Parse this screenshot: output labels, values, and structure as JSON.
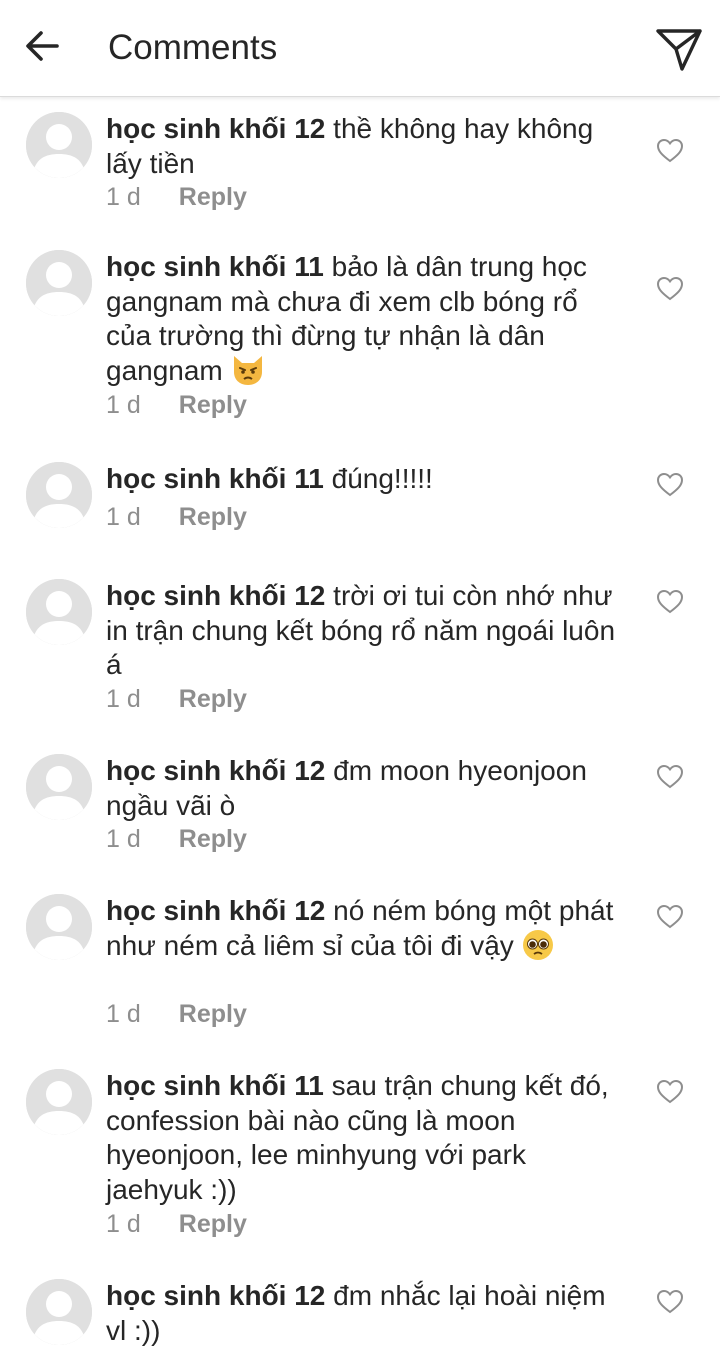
{
  "header": {
    "title": "Comments",
    "back_icon": "arrow-left-icon",
    "share_icon": "paper-plane-icon"
  },
  "comments": [
    {
      "username": "học sinh khối 12",
      "text": "thề không hay không lấy tiền",
      "time": "1 d",
      "reply": "Reply"
    },
    {
      "username": "học sinh khối 11",
      "text": "bảo là dân trung học gangnam mà chưa đi xem clb bóng rổ của trường thì đừng tự nhận là dân gangnam",
      "emoji": "angry-cat-emoji",
      "time": "1 d",
      "reply": "Reply"
    },
    {
      "username": "học sinh khối 11",
      "text": "đúng!!!!!",
      "time": "1 d",
      "reply": "Reply"
    },
    {
      "username": "học sinh khối 12",
      "text": "trời ơi tui còn nhớ như in trận chung kết bóng rổ năm ngoái luôn á",
      "time": "1 d",
      "reply": "Reply"
    },
    {
      "username": "học sinh khối 12",
      "text": "đm moon hyeonjoon ngầu vãi ò",
      "time": "1 d",
      "reply": "Reply"
    },
    {
      "username": "học sinh khối 12",
      "text": "nó ném bóng một phát như ném cả liêm sỉ của tôi đi vậy",
      "emoji": "pleading-face-emoji",
      "time": "1 d",
      "reply": "Reply"
    },
    {
      "username": "học sinh khối 11",
      "text": "sau trận chung kết đó, confession bài nào cũng là moon hyeonjoon, lee minhyung với park jaehyuk :))",
      "time": "1 d",
      "reply": "Reply"
    },
    {
      "username": "học sinh khối 12",
      "text": "đm nhắc lại hoài niệm vl :))"
    }
  ]
}
